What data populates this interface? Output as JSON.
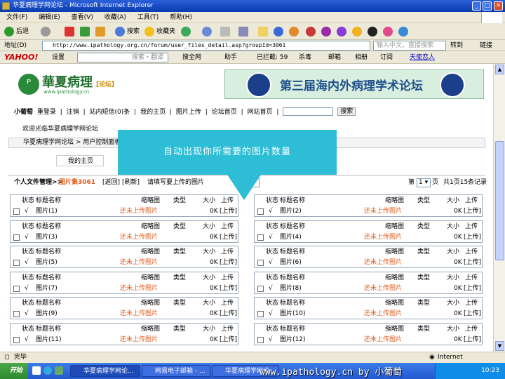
{
  "window": {
    "title": "华夏病理学网论坛 - Microsoft Internet Explorer"
  },
  "menu": [
    "文件(F)",
    "编辑(E)",
    "查看(V)",
    "收藏(A)",
    "工具(T)",
    "帮助(H)"
  ],
  "toolbar": {
    "back": "后退",
    "search": "搜索",
    "favorites": "收藏夹"
  },
  "address": {
    "label": "地址(D)",
    "url": "http://www.ipathology.org.cn/forum/user_files_detail.asp?groupId=3061",
    "search_placeholder": "输入中文，直接搜索",
    "go": "转到",
    "links": "链接"
  },
  "yahoo": {
    "logo": "YAHOO!",
    "settings": "设置",
    "search": "搜索・翻译",
    "full_search": "搜全网",
    "helper": "助手",
    "blocked": "已拦截: 59",
    "antivirus": "杀毒",
    "mail": "邮箱",
    "album": "相册",
    "rss": "订阅",
    "tianshi": "天使恋人"
  },
  "site": {
    "logo_name": "華夏病理",
    "logo_tag": "【论坛】",
    "logo_url": "www.ipathology.cn",
    "banner": "第三届海内外病理学术论坛"
  },
  "nav": [
    "小葡萄",
    "重登录",
    "|",
    "注销",
    "|",
    "站内短信(0)条",
    "|",
    "我的主页",
    "|",
    "图片上传",
    "|",
    "论坛首页",
    "|",
    "网站首页",
    "|"
  ],
  "search_button": "搜索",
  "welcome": "欢迎光临华夏病理学网论坛",
  "breadcrumb": "华夏病理学网论坛 > 用户控制面板",
  "tab": "我的主页",
  "callout": "自动出现你所需要的图片数量",
  "filebar": {
    "title": "个人文件管理>>",
    "group": "图片集3061",
    "back": "[返回]",
    "refresh": "[刷新]",
    "prompt": "请填写要上传的图片",
    "page_label": "第",
    "page_value": "1",
    "page_unit": "页",
    "total": "共1页15条记录"
  },
  "table_header": {
    "status": "状态",
    "title": "标题名称",
    "thumb": "缩略图",
    "type": "类型",
    "size": "大小",
    "upload": "上传"
  },
  "rows": [
    {
      "check": "√",
      "title": "图片(1)",
      "thumb": "还未上传图片",
      "size": "0K",
      "upload": "[上传]"
    },
    {
      "check": "√",
      "title": "图片(2)",
      "thumb": "还未上传图片",
      "size": "0K",
      "upload": "[上传]"
    },
    {
      "check": "√",
      "title": "图片(3)",
      "thumb": "还未上传图片",
      "size": "0K",
      "upload": "[上传]"
    },
    {
      "check": "√",
      "title": "图片(4)",
      "thumb": "还未上传图片",
      "size": "0K",
      "upload": "[上传]"
    },
    {
      "check": "√",
      "title": "图片(5)",
      "thumb": "还未上传图片",
      "size": "0K",
      "upload": "[上传]"
    },
    {
      "check": "√",
      "title": "图片(6)",
      "thumb": "还未上传图片",
      "size": "0K",
      "upload": "[上传]"
    },
    {
      "check": "√",
      "title": "图片(7)",
      "thumb": "还未上传图片",
      "size": "0K",
      "upload": "[上传]"
    },
    {
      "check": "√",
      "title": "图片(8)",
      "thumb": "还未上传图片",
      "size": "0K",
      "upload": "[上传]"
    },
    {
      "check": "√",
      "title": "图片(9)",
      "thumb": "还未上传图片",
      "size": "0K",
      "upload": "[上传]"
    },
    {
      "check": "√",
      "title": "图片(10)",
      "thumb": "还未上传图片",
      "size": "0K",
      "upload": "[上传]"
    },
    {
      "check": "√",
      "title": "图片(11)",
      "thumb": "还未上传图片",
      "size": "0K",
      "upload": "[上传]"
    },
    {
      "check": "√",
      "title": "图片(12)",
      "thumb": "还未上传图片",
      "size": "0K",
      "upload": "[上传]"
    }
  ],
  "status": {
    "text": "完毕",
    "zone": "Internet"
  },
  "taskbar": {
    "start": "开始",
    "tasks": [
      "华夏病理学网论...",
      "网易电子邮箱 - ...",
      "华夏病理学网论..."
    ],
    "time": "10:23"
  },
  "watermark": "www.ipathology.cn by 小葡萄"
}
